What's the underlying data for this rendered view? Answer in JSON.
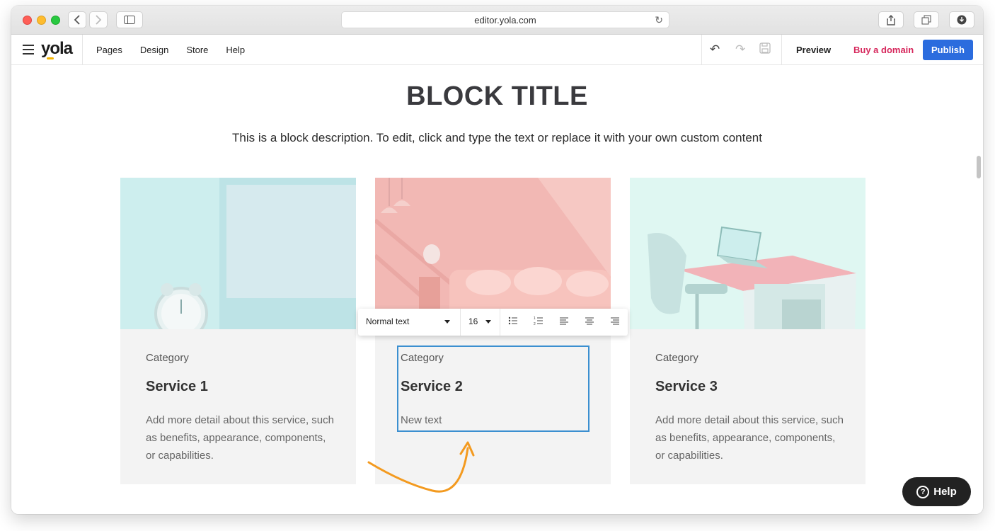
{
  "browser": {
    "url": "editor.yola.com"
  },
  "toolbar": {
    "logo": "yola",
    "nav": [
      "Pages",
      "Design",
      "Store",
      "Help"
    ],
    "preview_label": "Preview",
    "buy_domain_label": "Buy a domain",
    "publish_label": "Publish"
  },
  "block": {
    "title": "BLOCK TITLE",
    "description": "This is a block description. To edit, click and type the text or replace it with your own custom content"
  },
  "cards": [
    {
      "category": "Category",
      "service": "Service 1",
      "detail": "Add more detail about this service, such as benefits, appearance, components, or capabilities."
    },
    {
      "category": "Category",
      "service": "Service 2",
      "detail": "New text"
    },
    {
      "category": "Category",
      "service": "Service 3",
      "detail": "Add more detail about this service, such as benefits, appearance, components, or capabilities."
    }
  ],
  "format_toolbar": {
    "style": "Normal text",
    "font_size": "16"
  },
  "help_button": {
    "label": "Help"
  },
  "colors": {
    "accent": "#2b6cde",
    "buy_domain": "#d6265b",
    "arrow": "#f39a1f",
    "edit_border": "#3b8fd0"
  }
}
